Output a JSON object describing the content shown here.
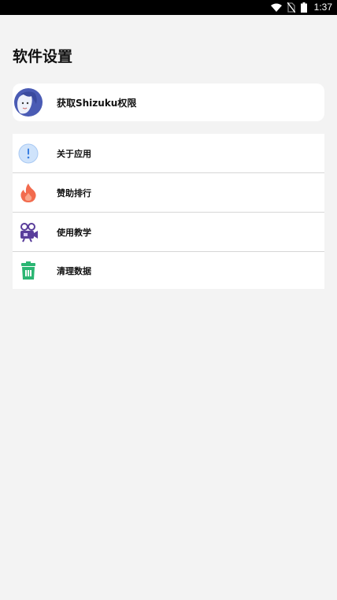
{
  "status_bar": {
    "time": "1:37",
    "icons": [
      "wifi-icon",
      "no-sim-icon",
      "battery-icon"
    ]
  },
  "page": {
    "title": "软件设置"
  },
  "shizuku_card": {
    "label": "获取Shizuku权限",
    "icon": "avatar-icon"
  },
  "menu": {
    "items": [
      {
        "label": "关于应用",
        "icon": "info-icon",
        "color": "#4a90e2"
      },
      {
        "label": "赞助排行",
        "icon": "flame-icon",
        "color": "#f26b4e"
      },
      {
        "label": "使用教学",
        "icon": "video-camera-icon",
        "color": "#5a3e9b"
      },
      {
        "label": "清理数据",
        "icon": "trash-icon",
        "color": "#2bb673"
      }
    ]
  },
  "colors": {
    "background": "#f3f3f3",
    "card": "#ffffff",
    "status_bar": "#000000",
    "divider": "#d6d6d6"
  }
}
